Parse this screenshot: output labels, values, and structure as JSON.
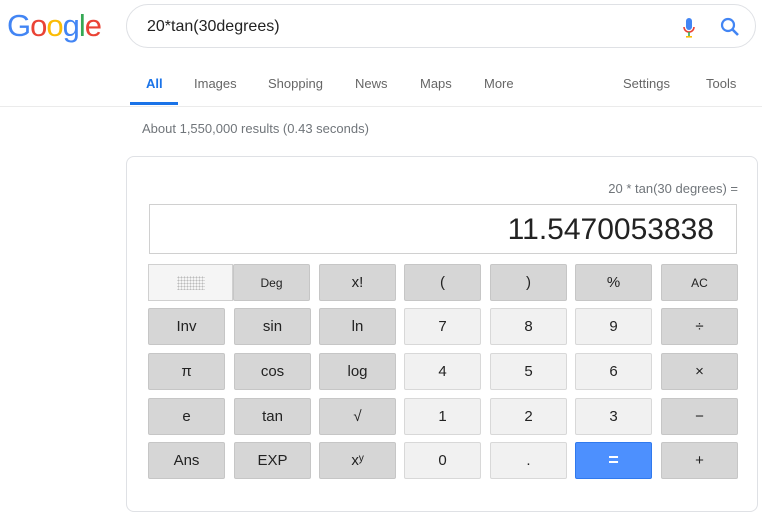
{
  "logo": {
    "text": "Google",
    "colors": [
      "#4285F4",
      "#EA4335",
      "#FBBC05",
      "#4285F4",
      "#34A853",
      "#EA4335"
    ]
  },
  "search": {
    "query": "20*tan(30degrees)",
    "icons": [
      "mic-icon",
      "search-icon"
    ]
  },
  "tabs": [
    "All",
    "Images",
    "Shopping",
    "News",
    "Maps",
    "More"
  ],
  "right_tabs": [
    "Settings",
    "Tools"
  ],
  "stats": "About 1,550,000 results (0.43 seconds)",
  "calculator": {
    "expression": "20 * tan(30 degrees) =",
    "result": "11.5470053838",
    "mode_selected": "Deg",
    "rows": [
      [
        "Deg",
        "x!",
        "(",
        ")",
        "%",
        "AC"
      ],
      [
        "Inv",
        "sin",
        "ln",
        "7",
        "8",
        "9",
        "÷"
      ],
      [
        "π",
        "cos",
        "log",
        "4",
        "5",
        "6",
        "×"
      ],
      [
        "e",
        "tan",
        "√",
        "1",
        "2",
        "3",
        "−"
      ],
      [
        "Ans",
        "EXP",
        "xʸ",
        "0",
        ".",
        "=",
        "+"
      ]
    ]
  },
  "accent": "#4d90fe"
}
